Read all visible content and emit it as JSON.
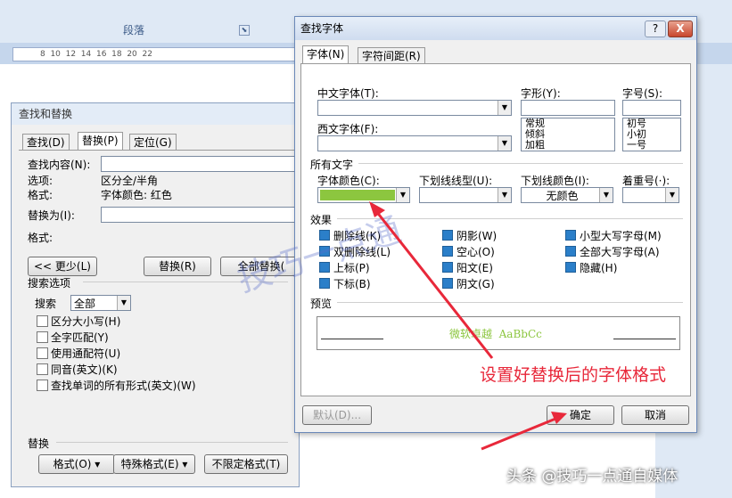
{
  "ribbon": {
    "group_label": "段落",
    "launcher": "⬊"
  },
  "ruler": {
    "ticks": "8  10  12  14  16  18  20  22"
  },
  "find_replace": {
    "title": "查找和替换",
    "tabs": [
      "查找(D)",
      "替换(P)",
      "定位(G)"
    ],
    "find_label": "查找内容(N):",
    "options_label": "选项:",
    "options_value": "区分全/半角",
    "format_label": "格式:",
    "format_value": "字体颜色: 红色",
    "replace_label": "替换为(I):",
    "replace_format_label": "格式:",
    "less_button": "<< 更少(L)",
    "replace_button": "替换(R)",
    "replace_all_button": "全部替换(",
    "search_options_label": "搜索选项",
    "search_label": "搜索",
    "search_value": "全部",
    "checkboxes": [
      "区分大小写(H)",
      "全字匹配(Y)",
      "使用通配符(U)",
      "同音(英文)(K)",
      "查找单词的所有形式(英文)(W)"
    ],
    "replace_section_label": "替换",
    "format_button": "格式(O) ▾",
    "special_button": "特殊格式(E) ▾",
    "no_format_button": "不限定格式(T)"
  },
  "find_font": {
    "title": "查找字体",
    "help": "?",
    "close": "X",
    "tabs": [
      "字体(N)",
      "字符间距(R)"
    ],
    "chinese_font_label": "中文字体(T):",
    "western_font_label": "西文字体(F):",
    "style_label": "字形(Y):",
    "style_options": [
      "常规",
      "倾斜",
      "加粗"
    ],
    "size_label": "字号(S):",
    "size_options": [
      "初号",
      "小初",
      "一号"
    ],
    "all_text_label": "所有文字",
    "font_color_label": "字体颜色(C):",
    "font_color_value": "#8cc63f",
    "underline_style_label": "下划线线型(U):",
    "underline_color_label": "下划线颜色(I):",
    "underline_color_value": "无颜色",
    "emphasis_label": "着重号(·):",
    "effects_label": "效果",
    "effects": [
      "删除线(K)",
      "阴影(W)",
      "小型大写字母(M)",
      "双删除线(L)",
      "空心(O)",
      "全部大写字母(A)",
      "上标(P)",
      "阳文(E)",
      "隐藏(H)",
      "下标(B)",
      "阴文(G)"
    ],
    "preview_label": "预览",
    "preview_text": "微软卓越  AaBbCc",
    "default_button": "默认(D)...",
    "ok_button": "确定",
    "cancel_button": "取消"
  },
  "annotation": "设置好替换后的字体格式",
  "watermark": "技巧一点通",
  "credit": "头条 @技巧一点通自媒体",
  "colors": {
    "accent_red": "#e8283a",
    "preview_green": "#8cc63f",
    "ribbon_blue": "#dfe9f5"
  }
}
